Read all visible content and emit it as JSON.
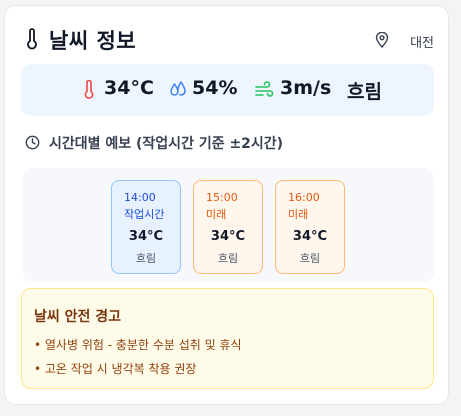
{
  "header": {
    "title": "날씨 정보",
    "location": "대전",
    "icons": {
      "title": "thermometer-icon",
      "location": "map-pin-icon"
    }
  },
  "summary": {
    "temperature": "34°C",
    "humidity": "54%",
    "wind": "3m/s",
    "condition": "흐림",
    "icons": {
      "temperature": "thermometer-icon",
      "humidity": "droplets-icon",
      "wind": "wind-icon"
    },
    "colors": {
      "temperature": "#ef4444",
      "humidity": "#3b82f6",
      "wind": "#22c55e"
    }
  },
  "forecast": {
    "title": "시간대별 예보 (작업시간 기준 ±2시간)",
    "icon": "clock-icon",
    "items": [
      {
        "time": "14:00",
        "tag": "작업시간",
        "temp": "34°C",
        "condition": "흐림",
        "current": true
      },
      {
        "time": "15:00",
        "tag": "미래",
        "temp": "34°C",
        "condition": "흐림",
        "current": false
      },
      {
        "time": "16:00",
        "tag": "미래",
        "temp": "34°C",
        "condition": "흐림",
        "current": false
      }
    ]
  },
  "warning": {
    "title": "날씨 안전 경고",
    "items": [
      "• 열사병 위험 - 충분한 수분 섭취 및 휴식",
      "• 고온 작업 시 냉각복 착용 권장"
    ]
  }
}
